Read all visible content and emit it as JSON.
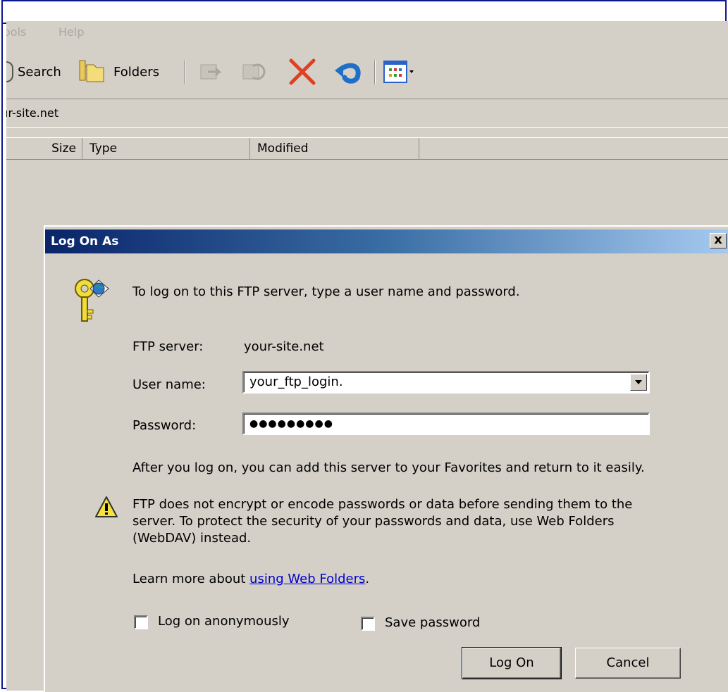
{
  "explorer": {
    "menu": [
      "ools",
      "Help"
    ],
    "toolbar": {
      "search_label": "Search",
      "folders_label": "Folders"
    },
    "address": "ır-site.net",
    "columns": [
      "Size",
      "Type",
      "Modified"
    ]
  },
  "dialog": {
    "title": "Log On As",
    "close_label": "x",
    "intro": "To log on to this FTP server, type a user name and password.",
    "server_label": "FTP server:",
    "server_value": "your-site.net",
    "username_label": "User name:",
    "username_value": "your_ftp_login.",
    "password_label": "Password:",
    "password_value": "●●●●●●●●●",
    "favorites_note": "After you log on, you can add this server to your Favorites and return to it easily.",
    "warning_line1": "FTP does not encrypt or encode passwords or data before sending them to the",
    "warning_line2": "server.  To protect the security of your passwords and data, use Web Folders",
    "warning_line3": "(WebDAV) instead.",
    "learn_prefix": "Learn more about ",
    "learn_link": "using Web Folders",
    "learn_suffix": ".",
    "anon_label": "Log on anonymously",
    "anon_checked": false,
    "save_label": "Save password",
    "save_checked": false,
    "logon_button": "Log On",
    "cancel_button": "Cancel"
  },
  "colors": {
    "title_start": "#0a246a",
    "title_end": "#a6caf0",
    "link": "#0000cc",
    "delete_icon": "#e04020",
    "undo_icon": "#1f6fc8"
  }
}
